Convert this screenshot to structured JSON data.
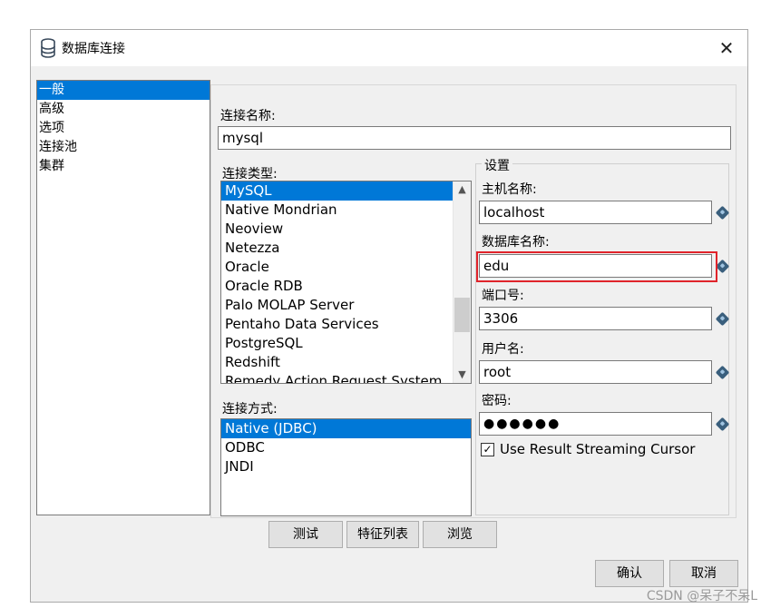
{
  "window": {
    "title": "数据库连接",
    "close_symbol": "✕"
  },
  "nav": {
    "items": [
      "一般",
      "高级",
      "选项",
      "连接池",
      "集群"
    ],
    "selected": 0
  },
  "connection_name": {
    "label": "连接名称:",
    "value": "mysql"
  },
  "connection_type": {
    "label": "连接类型:",
    "items": [
      "MySQL",
      "Native Mondrian",
      "Neoview",
      "Netezza",
      "Oracle",
      "Oracle RDB",
      "Palo MOLAP Server",
      "Pentaho Data Services",
      "PostgreSQL",
      "Redshift",
      "Remedy Action Request System"
    ],
    "selected": 0
  },
  "access_method": {
    "label": "连接方式:",
    "items": [
      "Native (JDBC)",
      "ODBC",
      "JNDI"
    ],
    "selected": 0
  },
  "settings": {
    "title": "设置",
    "host_label": "主机名称:",
    "host_value": "localhost",
    "db_label": "数据库名称:",
    "db_value": "edu",
    "port_label": "端口号:",
    "port_value": "3306",
    "user_label": "用户名:",
    "user_value": "root",
    "password_label": "密码:",
    "password_value": "●●●●●●",
    "streaming_label": "Use Result Streaming Cursor",
    "streaming_checked": true,
    "check_mark": "✓"
  },
  "buttons": {
    "test": "测试",
    "features": "特征列表",
    "browse": "浏览",
    "ok": "确认",
    "cancel": "取消"
  },
  "watermark": "CSDN @呆子不呆L",
  "colors": {
    "selection": "#0078d7",
    "highlight_border": "#e0242b"
  }
}
